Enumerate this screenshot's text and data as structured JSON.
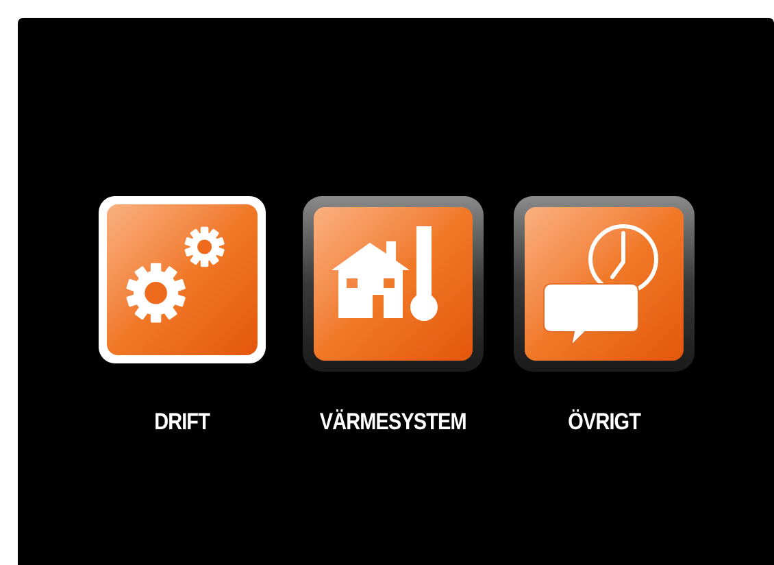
{
  "menu": [
    {
      "kind": "gears",
      "label": "DRIFT",
      "selected": true
    },
    {
      "kind": "house",
      "label": "VÄRMESYSTEM",
      "selected": false
    },
    {
      "kind": "clock",
      "label": "ÖVRIGT",
      "selected": false
    }
  ]
}
